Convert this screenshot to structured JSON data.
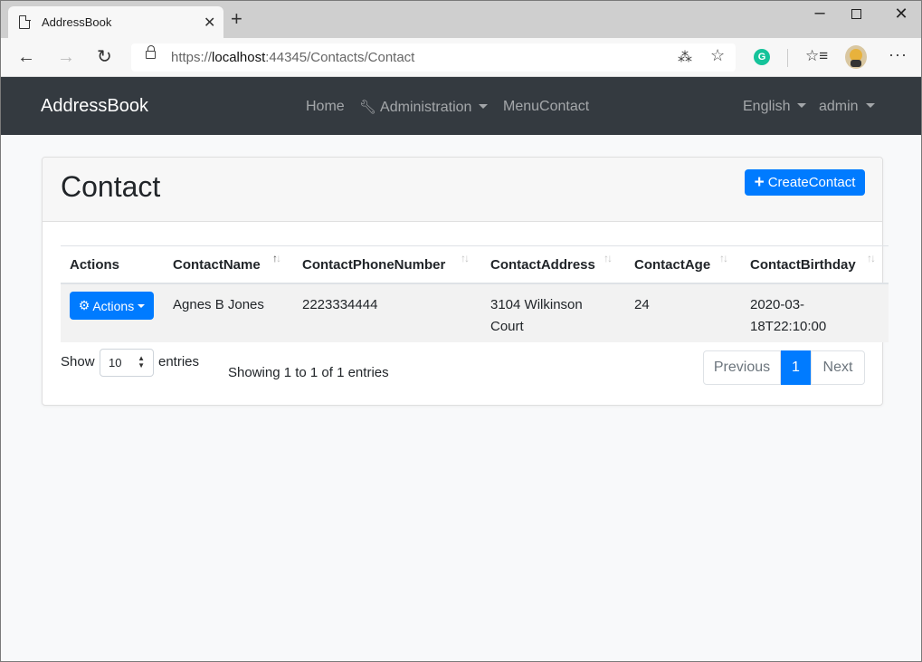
{
  "browser": {
    "tab_title": "AddressBook",
    "tab_close": "✕",
    "new_tab": "+",
    "url_scheme": "https://",
    "url_host": "localhost",
    "url_rest": ":44345/Contacts/Contact",
    "icons": [
      "page-icon",
      "back-icon",
      "forward-icon",
      "refresh-icon",
      "lock-icon",
      "translate-icon",
      "star-icon",
      "grammarly-icon",
      "favorites-icon",
      "profile-icon",
      "more-icon"
    ],
    "grammarly_letter": "G"
  },
  "navbar": {
    "brand": "AddressBook",
    "home": "Home",
    "administration": "Administration",
    "menu_contact": "MenuContact",
    "language": "English",
    "user": "admin",
    "bg_color": "#343a40"
  },
  "page": {
    "title": "Contact",
    "create_button": "CreateContact",
    "accent_color": "#007bff"
  },
  "table": {
    "columns": [
      "Actions",
      "ContactName",
      "ContactPhoneNumber",
      "ContactAddress",
      "ContactAge",
      "ContactBirthday"
    ],
    "rows": [
      {
        "actions_label": "Actions",
        "name": "Agnes B Jones",
        "phone": "2223334444",
        "address_line1": "3104 Wilkinson",
        "address_line2": "Court",
        "age": "24",
        "birthday_line1": "2020-03-",
        "birthday_line2": "18T22:10:00"
      }
    ]
  },
  "footer": {
    "show": "Show",
    "page_size": "10",
    "entries": "entries",
    "info": "Showing 1 to 1 of 1 entries",
    "previous": "Previous",
    "current_page": "1",
    "next": "Next"
  }
}
